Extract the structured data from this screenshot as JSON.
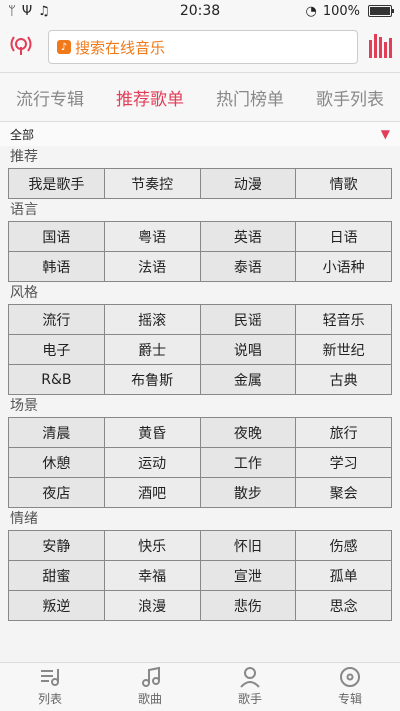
{
  "status": {
    "time": "20:38",
    "battery": "100%"
  },
  "search": {
    "placeholder": "搜索在线音乐"
  },
  "tabs": [
    "流行专辑",
    "推荐歌单",
    "热门榜单",
    "歌手列表"
  ],
  "filter": {
    "all": "全部"
  },
  "sections": [
    {
      "label": "推荐",
      "items": [
        "我是歌手",
        "节奏控",
        "动漫",
        "情歌"
      ]
    },
    {
      "label": "语言",
      "items": [
        "国语",
        "粤语",
        "英语",
        "日语",
        "韩语",
        "法语",
        "泰语",
        "小语种"
      ]
    },
    {
      "label": "风格",
      "items": [
        "流行",
        "摇滚",
        "民谣",
        "轻音乐",
        "电子",
        "爵士",
        "说唱",
        "新世纪",
        "R&B",
        "布鲁斯",
        "金属",
        "古典"
      ]
    },
    {
      "label": "场景",
      "items": [
        "清晨",
        "黄昏",
        "夜晚",
        "旅行",
        "休憩",
        "运动",
        "工作",
        "学习",
        "夜店",
        "酒吧",
        "散步",
        "聚会"
      ]
    },
    {
      "label": "情绪",
      "items": [
        "安静",
        "快乐",
        "怀旧",
        "伤感",
        "甜蜜",
        "幸福",
        "宣泄",
        "孤单",
        "叛逆",
        "浪漫",
        "悲伤",
        "思念"
      ]
    }
  ],
  "bottom_nav": [
    "列表",
    "歌曲",
    "歌手",
    "专辑"
  ]
}
